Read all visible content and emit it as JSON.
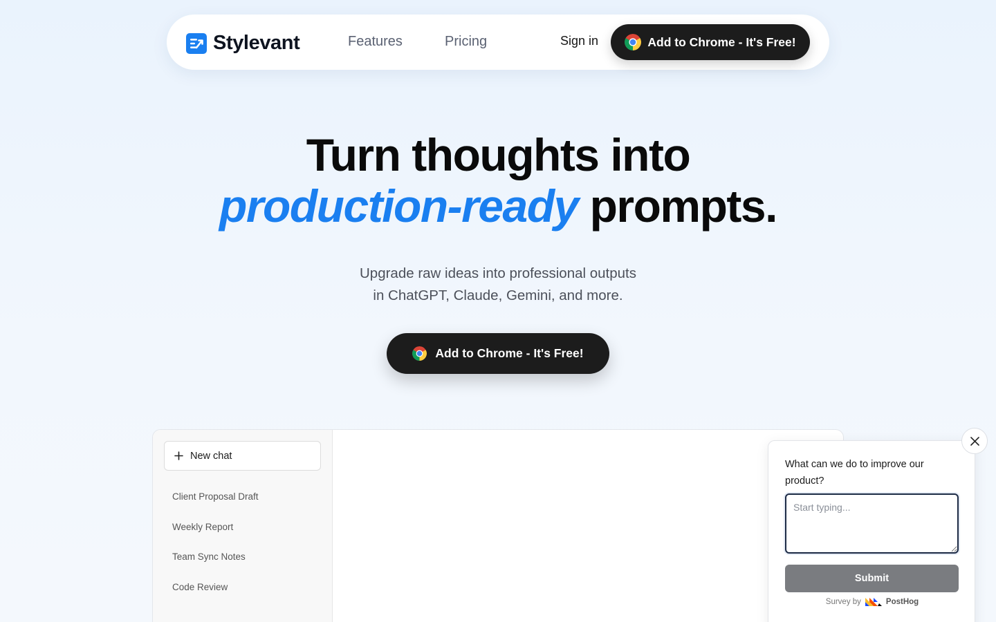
{
  "nav": {
    "brand": "Stylevant",
    "links": [
      {
        "label": "Features"
      },
      {
        "label": "Pricing"
      }
    ],
    "sign_in": "Sign in",
    "cta": "Add to Chrome - It's Free!"
  },
  "hero": {
    "line1": "Turn thoughts into",
    "accent": "production-ready",
    "line2_rest": "prompts.",
    "subtitle_line1": "Upgrade raw ideas into professional outputs",
    "subtitle_line2": "in ChatGPT, Claude, Gemini, and more.",
    "cta": "Add to Chrome - It's Free!"
  },
  "app_preview": {
    "new_chat": "New chat",
    "chats": [
      {
        "label": "Client Proposal Draft"
      },
      {
        "label": "Weekly Report"
      },
      {
        "label": "Team Sync Notes"
      },
      {
        "label": "Code Review"
      }
    ]
  },
  "survey": {
    "question": "What can we do to improve our product?",
    "placeholder": "Start typing...",
    "submit": "Submit",
    "footer_prefix": "Survey by",
    "footer_brand": "PostHog"
  },
  "colors": {
    "accent": "#1a7ff0",
    "cta_bg": "#1c1c1c",
    "submit_bg": "#7a7c80"
  },
  "icons": {
    "logo": "stylevant-logo-icon",
    "browser": "chrome-icon",
    "plus": "plus-icon",
    "close": "close-icon",
    "posthog": "posthog-logo-icon"
  }
}
